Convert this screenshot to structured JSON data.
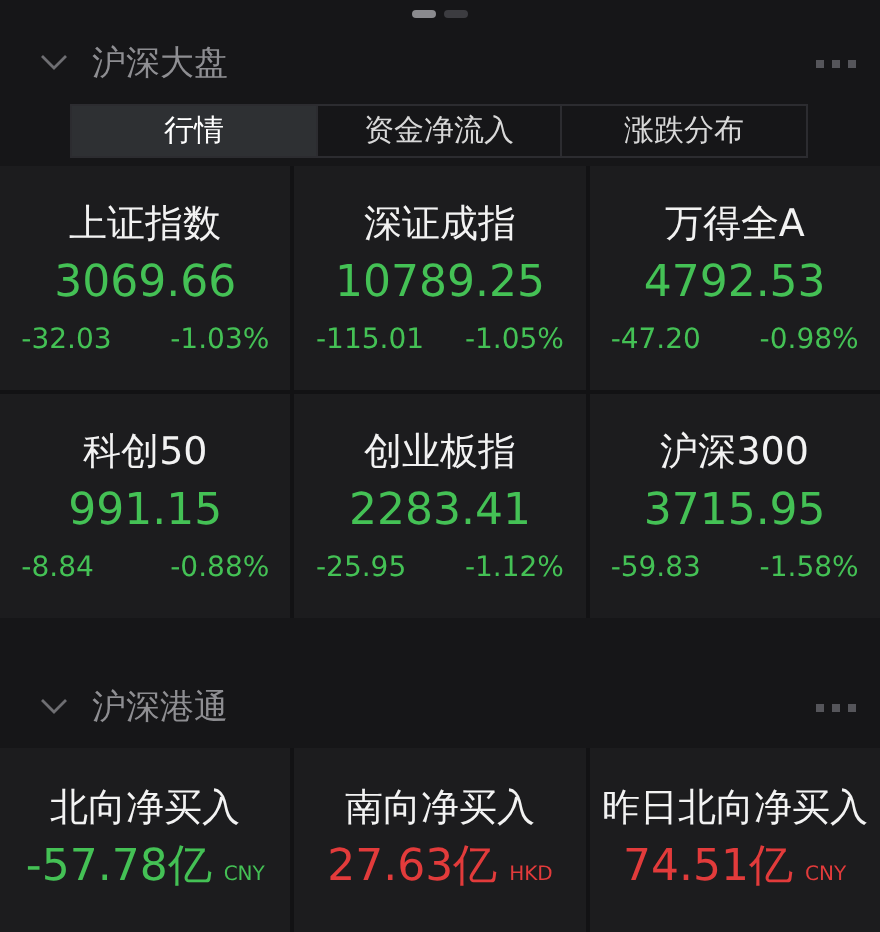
{
  "pager": [
    {
      "selected": true
    },
    {
      "selected": false
    }
  ],
  "market": {
    "title": "沪深大盘",
    "expanded": true,
    "tabs": [
      {
        "label": "行情",
        "selected": true
      },
      {
        "label": "资金净流入",
        "selected": false
      },
      {
        "label": "涨跌分布",
        "selected": false
      }
    ],
    "indices": [
      {
        "name": "上证指数",
        "value": "3069.66",
        "change": "-32.03",
        "percent": "-1.03%",
        "color": "#44c155"
      },
      {
        "name": "深证成指",
        "value": "10789.25",
        "change": "-115.01",
        "percent": "-1.05%",
        "color": "#44c155"
      },
      {
        "name": "万得全A",
        "value": "4792.53",
        "change": "-47.20",
        "percent": "-0.98%",
        "color": "#44c155"
      },
      {
        "name": "科创50",
        "value": "991.15",
        "change": "-8.84",
        "percent": "-0.88%",
        "color": "#44c155"
      },
      {
        "name": "创业板指",
        "value": "2283.41",
        "change": "-25.95",
        "percent": "-1.12%",
        "color": "#44c155"
      },
      {
        "name": "沪深300",
        "value": "3715.95",
        "change": "-59.83",
        "percent": "-1.58%",
        "color": "#44c155"
      }
    ]
  },
  "connect": {
    "title": "沪深港通",
    "expanded": true,
    "flows": [
      {
        "name": "北向净买入",
        "value": "-57.78亿",
        "currency": "CNY",
        "color": "#44c155"
      },
      {
        "name": "南向净买入",
        "value": "27.63亿",
        "currency": "HKD",
        "color": "#e23b3b"
      },
      {
        "name": "昨日北向净买入",
        "value": "74.51亿",
        "currency": "CNY",
        "color": "#e23b3b"
      }
    ]
  }
}
